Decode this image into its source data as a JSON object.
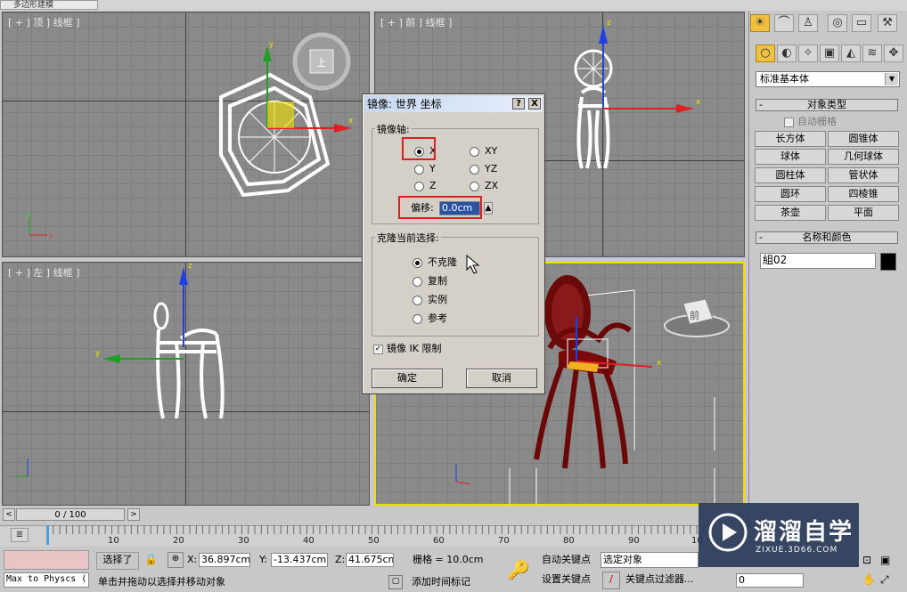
{
  "top_tab": "多边形建模",
  "viewports": {
    "top": "[ + ] 顶 ] 线框 ]",
    "front": "[ + ] 前 ] 线框 ]",
    "left": "[ + ] 左 ] 线框 ]",
    "perspective_cube_label": "前",
    "top_cube_label": "上"
  },
  "dialog": {
    "title": "镜像: 世界 坐标",
    "help_btn": "?",
    "close_btn": "X",
    "mirror_axis_label": "镜像轴:",
    "axes": [
      {
        "label": "X",
        "selected": true
      },
      {
        "label": "Y",
        "selected": false
      },
      {
        "label": "Z",
        "selected": false
      },
      {
        "label": "XY",
        "selected": false
      },
      {
        "label": "YZ",
        "selected": false
      },
      {
        "label": "ZX",
        "selected": false
      }
    ],
    "offset_label": "偏移:",
    "offset_value": "0.0cm",
    "clone_label": "克隆当前选择:",
    "clone_options": [
      {
        "label": "不克隆",
        "selected": true
      },
      {
        "label": "复制",
        "selected": false
      },
      {
        "label": "实例",
        "selected": false
      },
      {
        "label": "参考",
        "selected": false
      }
    ],
    "ik_label": "镜像 IK 限制",
    "ik_checked": true,
    "ok": "确定",
    "cancel": "取消"
  },
  "command_panel": {
    "dropdown": "标准基本体",
    "object_type_title": "对象类型",
    "auto_grid": "自动栅格",
    "buttons": [
      "长方体",
      "圆锥体",
      "球体",
      "几何球体",
      "圆柱体",
      "管状体",
      "圆环",
      "四棱锥",
      "茶壶",
      "平面"
    ],
    "name_color_title": "名称和颜色",
    "name_value": "組02",
    "color_swatch": "#000000"
  },
  "timeline": {
    "slider_label": "0 / 100",
    "ticks": [
      "10",
      "20",
      "30",
      "40",
      "50",
      "60",
      "70",
      "80",
      "90",
      "10"
    ]
  },
  "status": {
    "script_field": "Max to Physcs (",
    "selected": "选择了",
    "x_label": "X:",
    "x_value": "36.897cm",
    "y_label": "Y:",
    "y_value": "-13.437cm",
    "z_label": "Z:",
    "z_value": "41.675cm",
    "grid": "栅格 = 10.0cm",
    "auto_key": "自动关键点",
    "set_key": "设置关键点",
    "selection_dropdown": "选定对象",
    "key_filter": "关键点过滤器...",
    "prompt": "单击并拖动以选择并移动对象",
    "add_time_tag": "添加时间标记",
    "frame_value": "0"
  },
  "watermark": {
    "brand": "溜溜自学",
    "url": "ZIXUE.3D66.COM"
  },
  "accent_colors": {
    "active_viewport": "#f0e000",
    "highlight_box": "#e02020",
    "chair_dark": "#7a0a0a"
  }
}
